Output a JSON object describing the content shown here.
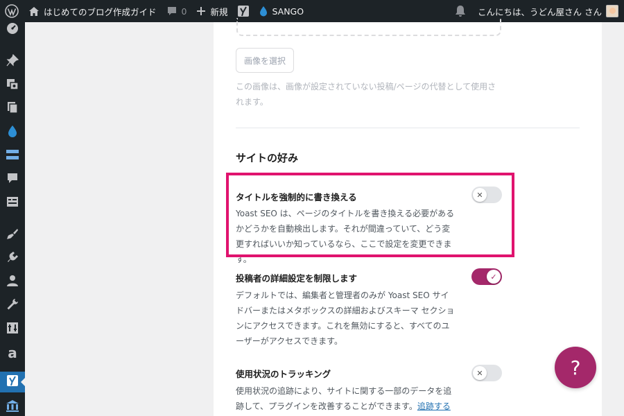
{
  "admin_bar": {
    "wp_logo_icon": "wordpress-icon",
    "site_name": "はじめてのブログ作成ガイド",
    "comments_count": "0",
    "new_label": "新規",
    "yoast_icon": "yoast-icon",
    "theme_label": "SANGO",
    "greeting": "こんにちは、うどん屋さん さん"
  },
  "sidebar": {
    "items": [
      {
        "icon": "dashboard-icon"
      },
      {
        "icon": "pin-icon"
      },
      {
        "icon": "media-icon"
      },
      {
        "icon": "pages-icon"
      },
      {
        "icon": "drop-icon"
      },
      {
        "icon": "sections-icon"
      },
      {
        "icon": "comments-icon"
      },
      {
        "icon": "forms-icon"
      },
      {
        "icon": "appearance-icon"
      },
      {
        "icon": "plugins-icon"
      },
      {
        "icon": "users-icon"
      },
      {
        "icon": "tools-icon"
      },
      {
        "icon": "settings-icon"
      },
      {
        "icon": "amazon-icon"
      },
      {
        "icon": "yoast-icon"
      },
      {
        "icon": "bank-icon"
      }
    ],
    "current_index": 14
  },
  "image_section": {
    "select_button": "画像を選択",
    "help_text": "この画像は、画像が設定されていない投稿/ページの代替として使用されます。"
  },
  "site_preferences": {
    "title": "サイトの好み",
    "settings": [
      {
        "title": "タイトルを強制的に書き換える",
        "description": "Yoast SEO は、ページのタイトルを書き換える必要があるかどうかを自動検出します。それが間違っていて、どう変更すればいいか知っているなら、ここで設定を変更できます。",
        "enabled": false,
        "highlighted": true
      },
      {
        "title": "投稿者の詳細設定を制限します",
        "description": "デフォルトでは、編集者と管理者のみが Yoast SEO サイドバーまたはメタボックスの詳細およびスキーマ セクションにアクセスできます。これを無効にすると、すべてのユーザーがアクセスできます。",
        "enabled": true,
        "highlighted": false
      },
      {
        "title": "使用状況のトラッキング",
        "description": "使用状況の追跡により、サイトに関する一部のデータを追跡して、プラグインを改善することができます。",
        "link_text": "追跡するデータとその理由の詳細をご覧ください",
        "enabled": false,
        "highlighted": false
      }
    ]
  },
  "help_bubble": {
    "label": "?"
  },
  "colors": {
    "accent": "#a4286a",
    "highlight_border": "#e0136e",
    "admin_bar": "#1d2327",
    "sidebar_current": "#2271b1"
  }
}
